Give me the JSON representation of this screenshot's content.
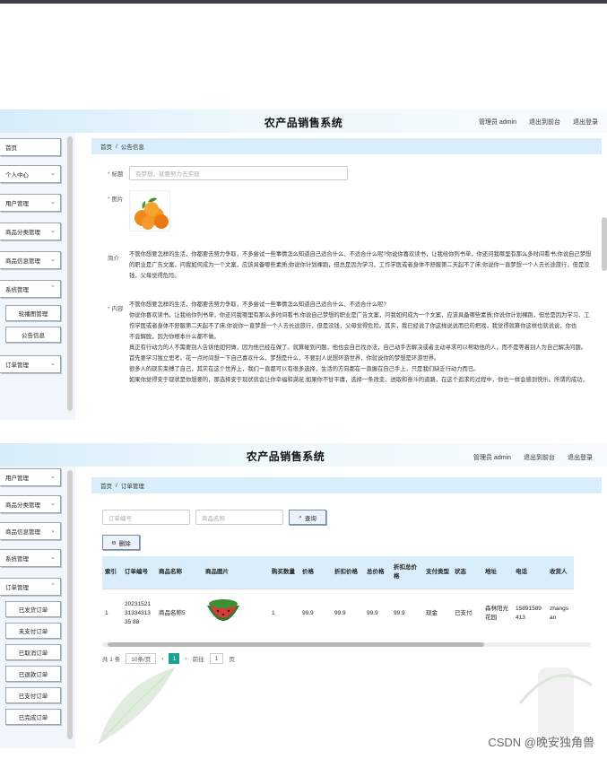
{
  "app_title": "农产品销售系统",
  "header_nav": {
    "admin": "管理员 admin",
    "front": "退出到前台",
    "logout": "退出登录"
  },
  "shot1": {
    "sidebar": [
      "首页",
      "个人中心",
      "用户管理",
      "商品分类管理",
      "商品信息管理",
      "系统管理"
    ],
    "sidebar_sub": [
      "轮播图管理",
      "公告信息"
    ],
    "sidebar_last": "订单管理",
    "breadcrumb": {
      "home": "首页",
      "sep": "/",
      "current": "公告信息"
    },
    "form": {
      "title_label": "标题",
      "title_value": "有梦想，就要努力去实现",
      "image_label": "图片",
      "intro_label": "简介",
      "intro_lines": [
        "不管你想要怎样的生活，你都要去努力争取，不多尝试一些事情怎么知道自己适合什么、不适合什么呢?你说你喜欢读书，让我给你列书单，你还问我哪里有那么多时间看书;你说自己梦想",
        "的职业是广告文案，问我如何成为一个文案，应该具备哪些素质;你说你计划裸跑，但总是因为学习、工作学医或者身体不舒服第二天起不了床;你说你一直梦想一个人去长途旅行，但是没",
        "钱，父母觉得危险。"
      ],
      "content_label": "内容",
      "content_lines": [
        "不管你想要怎样的生活，你都要去努力争取，不多尝试一些事情怎么知道自己适合什么、不适合什么呢?",
        "你说你喜欢读书，让我给你列书单，你还问我哪里有那么多时间看书;你说自己梦想的职业是广告文案，问我如何成为一个文案，应该具备哪些素质;你说你计划裸跑，但总是因为学习、工",
        "作学医或者身体不舒服第二天起不了床;你说你一直梦想一个人去长途旅行，但是没钱，父母觉得危险。其实，我已经说了你这样说说而已的把戏，我觉得就算你这样也就说说，你也",
        "不会解脱，因为你根本什么都不做。",
        "真正有行动力的人不需要别人告诉他如何做，因为他已经在做了。就算碰到问题，他也会自己找办法，自己动手去解决或者主动寻求可以帮助他的人，而不是等着别人为自己解决问题。",
        "首先要学习独立思考。花一点时间想一下自己喜欢什么，梦想是什么，不要别人说想环游世界，你就说你的梦想是环游世界。",
        "很多人的现实束缚了自己，其实在这个世界上，我们一直都可以有很多选择，生活的方向都在一直握在自己手上，只是我们缺乏行动力而已。",
        "如果你觉得安于现状是你想要的，那选择安于现状就会让你幸福和满足;如果你不甘平庸，选择一条改变、进取和奋斗的道路，在这个追求的过程中，你也一样会感到快乐。所谓的成功，"
      ]
    }
  },
  "shot2": {
    "sidebar": [
      "用户管理",
      "商品分类管理",
      "商品信息管理",
      "系统管理",
      "订单管理"
    ],
    "sidebar_sub": [
      "已发货订单",
      "未支付订单",
      "已取消订单",
      "已退款订单",
      "已支付订单",
      "已完成订单"
    ],
    "breadcrumb": {
      "home": "首页",
      "sep": "/",
      "current": "订单管理"
    },
    "search": {
      "order_no_placeholder": "订单编号",
      "product_placeholder": "商品名称",
      "query_label": "查询"
    },
    "delete_label": "删除",
    "table": {
      "headers": [
        "索引",
        "订单编号",
        "商品名称",
        "商品图片",
        "购买数量",
        "价格",
        "折扣价格",
        "总价格",
        "折扣总价格",
        "支付类型",
        "状态",
        "地址",
        "电话",
        "收货人"
      ],
      "row": {
        "index": "1",
        "order_no": "202315213133431335 88",
        "product": "商品名称5",
        "qty": "1",
        "price": "99.9",
        "discount_price": "99.9",
        "total": "99.9",
        "discount_total": "99.9",
        "pay_type": "现金",
        "status": "已支付",
        "address": "森林阳光花园",
        "phone": "15891589413",
        "receiver": "zhangsan"
      }
    },
    "pager": {
      "total": "共 1 条",
      "size": "10条/页",
      "page": "1",
      "goto": "前往",
      "goto_value": "1",
      "unit": "页"
    }
  },
  "watermark": "CSDN @晚安独角兽"
}
